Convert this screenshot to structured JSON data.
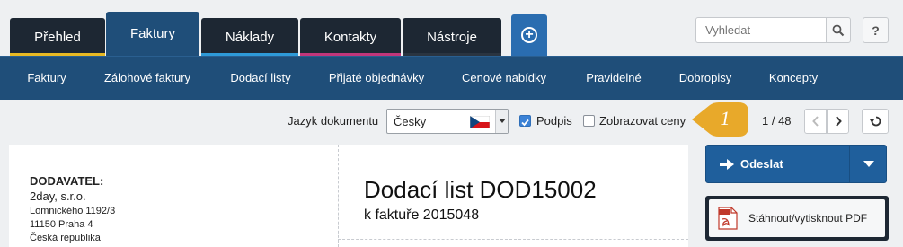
{
  "main_tabs": [
    {
      "label": "Přehled",
      "stripe": "#e8b923",
      "active": false
    },
    {
      "label": "Faktury",
      "stripe": "#1f4e79",
      "active": true
    },
    {
      "label": "Náklady",
      "stripe": "#2e9ad8",
      "active": false
    },
    {
      "label": "Kontakty",
      "stripe": "#c2367a",
      "active": false
    },
    {
      "label": "Nástroje",
      "stripe": "#2a3440",
      "active": false
    }
  ],
  "add_tab_icon": "plus-circle-icon",
  "search": {
    "placeholder": "Vyhledat",
    "icon": "search-icon"
  },
  "help": {
    "label": "?"
  },
  "sub_tabs": [
    {
      "label": "Faktury"
    },
    {
      "label": "Zálohové faktury"
    },
    {
      "label": "Dodací listy"
    },
    {
      "label": "Přijaté objednávky"
    },
    {
      "label": "Cenové nabídky"
    },
    {
      "label": "Pravidelné"
    },
    {
      "label": "Dobropisy"
    },
    {
      "label": "Koncepty"
    }
  ],
  "toolbar": {
    "language_label": "Jazyk dokumentu",
    "language_value": "Česky",
    "flag_icon": "czech-flag-icon",
    "signature_label": "Podpis",
    "signature_checked": true,
    "show_prices_label": "Zobrazovat ceny",
    "show_prices_checked": false,
    "badge_number": "1",
    "badge_color": "#e8a92a",
    "pager_text": "1 / 48"
  },
  "document": {
    "supplier_heading": "DODAVATEL:",
    "supplier_name": "2day, s.r.o.",
    "supplier_street": "Lomnického 1192/3",
    "supplier_city": "11150 Praha 4",
    "supplier_country": "Česká republika",
    "title": "Dodací list DOD15002",
    "subtitle": "k faktuře 2015048"
  },
  "actions": {
    "send_label": "Odeslat",
    "pdf_label": "Stáhnout/vytisknout PDF",
    "accent": "#1f5f9c"
  }
}
